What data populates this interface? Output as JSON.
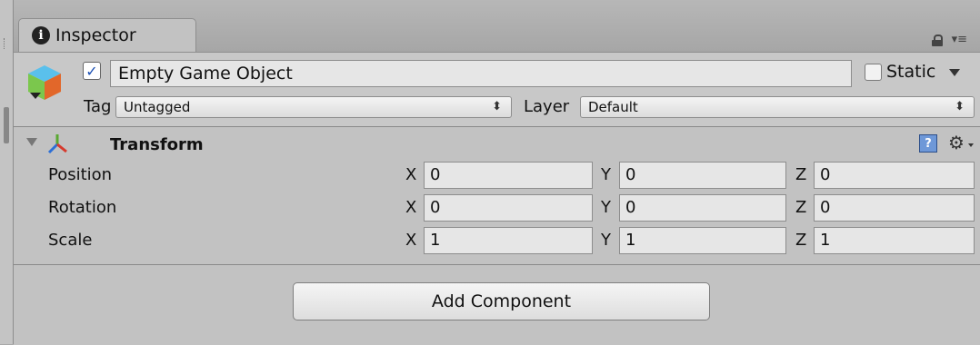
{
  "tab": {
    "title": "Inspector",
    "icon": "info-icon"
  },
  "game_object": {
    "active": true,
    "name": "Empty Game Object",
    "static_label": "Static",
    "static_checked": false,
    "tag_label": "Tag",
    "tag_value": "Untagged",
    "layer_label": "Layer",
    "layer_value": "Default"
  },
  "transform": {
    "title": "Transform",
    "rows": [
      {
        "label": "Position",
        "x": "0",
        "y": "0",
        "z": "0"
      },
      {
        "label": "Rotation",
        "x": "0",
        "y": "0",
        "z": "0"
      },
      {
        "label": "Scale",
        "x": "1",
        "y": "1",
        "z": "1"
      }
    ],
    "axes": {
      "x": "X",
      "y": "Y",
      "z": "Z"
    }
  },
  "add_component_label": "Add Component",
  "colors": {
    "panel_bg": "#c2c2c2",
    "field_bg": "#e6e6e6",
    "check_blue": "#1b4fb3"
  }
}
